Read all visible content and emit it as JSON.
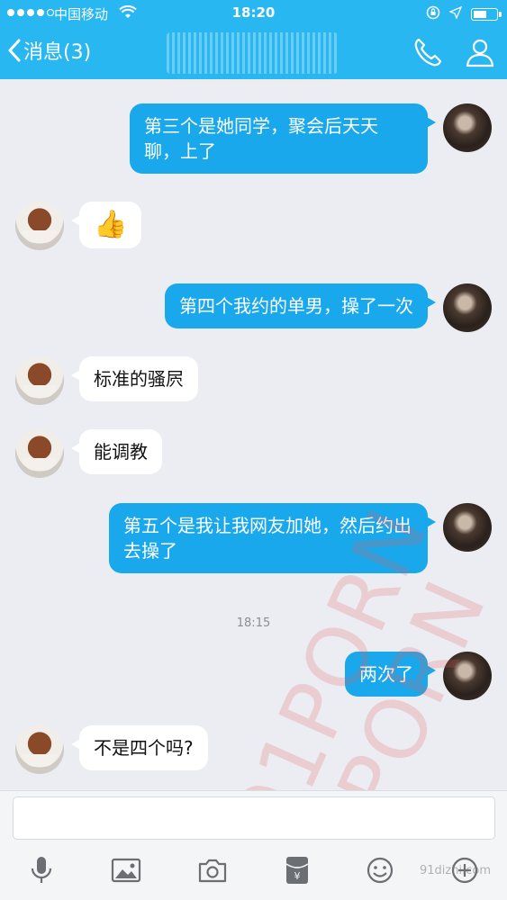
{
  "status_bar": {
    "carrier": "中国移动",
    "time": "18:20",
    "battery_level": 0.6
  },
  "nav": {
    "back_label": "消息(3)",
    "title": "",
    "icons": [
      "back-chevron-icon",
      "phone-icon",
      "profile-icon"
    ]
  },
  "messages": [
    {
      "side": "out",
      "text": "第三个是她同学，聚会后天天聊，上了"
    },
    {
      "side": "in",
      "text": "👍"
    },
    {
      "side": "out",
      "text": "第四个我约的单男，操了一次"
    },
    {
      "side": "in",
      "text": "标准的骚屄"
    },
    {
      "side": "in",
      "text": "能调教"
    },
    {
      "side": "out",
      "text": "第五个是我让我网友加她，然后约出去操了"
    },
    {
      "side": "out",
      "text": "两次了"
    },
    {
      "side": "in",
      "text": "不是四个吗?"
    }
  ],
  "timestamp": "18:15",
  "watermarks": {
    "text": "91PORN",
    "site": "91dizhi.com"
  },
  "input": {
    "placeholder": ""
  },
  "toolbar": {
    "icons": [
      "microphone-icon",
      "image-icon",
      "camera-icon",
      "red-packet-icon",
      "emoji-icon",
      "plus-icon"
    ]
  },
  "colors": {
    "nav_bg": "#29b7f1",
    "outgoing_bubble": "#19a8ec",
    "incoming_bubble": "#ffffff",
    "chat_bg": "#ebedf2"
  }
}
